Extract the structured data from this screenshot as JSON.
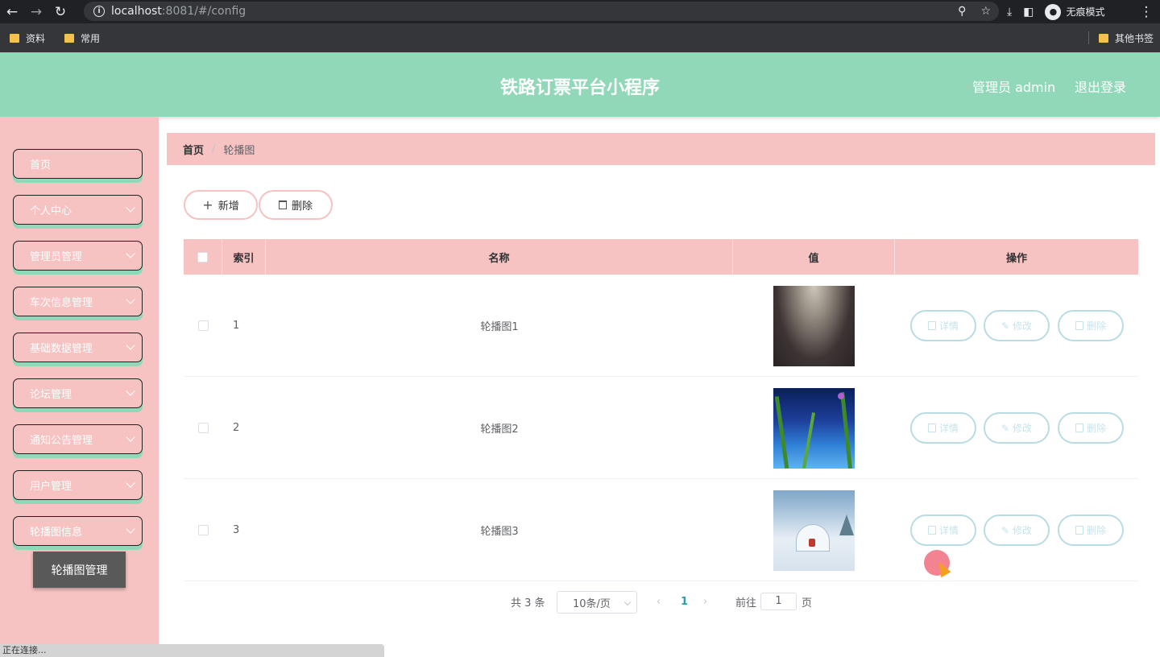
{
  "browser": {
    "url_host": "localhost",
    "url_rest": ":8081/#/config",
    "incognito_label": "无痕模式",
    "bookmarks": [
      "资料",
      "常用"
    ],
    "other_bookmarks": "其他书签",
    "status_text": "正在连接..."
  },
  "header": {
    "title": "铁路订票平台小程序",
    "admin": "管理员 admin",
    "logout": "退出登录"
  },
  "sidebar": {
    "items": [
      {
        "label": "首页"
      },
      {
        "label": "个人中心"
      },
      {
        "label": "管理员管理"
      },
      {
        "label": "车次信息管理"
      },
      {
        "label": "基础数据管理"
      },
      {
        "label": "论坛管理"
      },
      {
        "label": "通知公告管理"
      },
      {
        "label": "用户管理"
      },
      {
        "label": "轮播图信息"
      }
    ],
    "sub_item": "轮播图管理"
  },
  "breadcrumb": {
    "home": "首页",
    "current": "轮播图"
  },
  "toolbar": {
    "add": "新增",
    "delete": "删除"
  },
  "table": {
    "headers": {
      "index": "索引",
      "name": "名称",
      "value": "值",
      "action": "操作"
    },
    "rows": [
      {
        "index": "1",
        "name": "轮播图1"
      },
      {
        "index": "2",
        "name": "轮播图2"
      },
      {
        "index": "3",
        "name": "轮播图3"
      }
    ],
    "actions": {
      "detail": "详情",
      "edit": "修改",
      "delete": "删除"
    }
  },
  "pagination": {
    "total": "共 3 条",
    "page_size": "10条/页",
    "current_page": "1",
    "goto_label": "前往",
    "goto_value": "1",
    "page_suffix": "页"
  },
  "colors": {
    "header": "#90d8b7",
    "sidebar": "#f6c2c2",
    "accent_pink": "#f6c2c2",
    "action_border": "#b9dce4",
    "submenu": "#595959"
  }
}
